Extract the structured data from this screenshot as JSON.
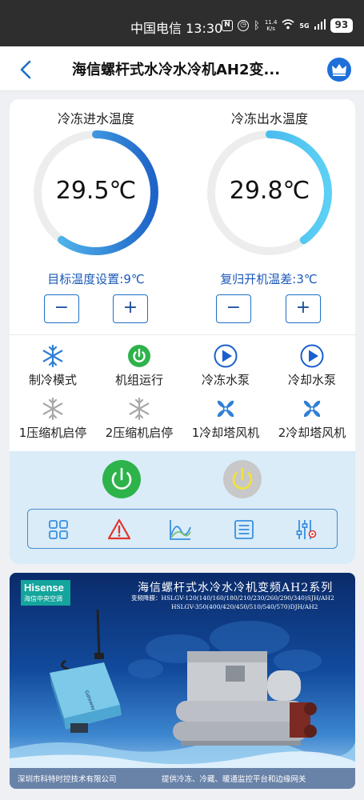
{
  "status_bar": {
    "carrier": "中国电信",
    "time": "13:30",
    "net_speed_value": "11.4",
    "net_speed_unit": "K/s",
    "network": "5G",
    "battery": "93"
  },
  "header": {
    "title": "海信螺杆式水冷水冷机AH2变...",
    "back_icon": "chevron-left-icon",
    "crown_icon": "crown-icon"
  },
  "gauges": [
    {
      "title": "冷冻进水温度",
      "value": "29.5℃",
      "fill_fraction": 0.6
    },
    {
      "title": "冷冻出水温度",
      "value": "29.8℃",
      "fill_fraction": 0.4
    }
  ],
  "settings": [
    {
      "label": "目标温度设置:9℃",
      "minus": "−",
      "plus": "+"
    },
    {
      "label": "复归开机温差:3℃",
      "minus": "−",
      "plus": "+"
    }
  ],
  "status_items": [
    {
      "label": "制冷模式",
      "icon": "snowflake-icon",
      "active": true
    },
    {
      "label": "机组运行",
      "icon": "power-on-icon",
      "active": true
    },
    {
      "label": "冷冻水泵",
      "icon": "play-icon",
      "active": true
    },
    {
      "label": "冷却水泵",
      "icon": "play-icon",
      "active": true
    },
    {
      "label": "1压缩机启停",
      "icon": "snowflake-icon",
      "active": false
    },
    {
      "label": "2压缩机启停",
      "icon": "snowflake-icon",
      "active": false
    },
    {
      "label": "1冷却塔风机",
      "icon": "fan-icon",
      "active": true
    },
    {
      "label": "2冷却塔风机",
      "icon": "fan-icon",
      "active": true
    }
  ],
  "controls": {
    "power_on_icon": "power-on-icon",
    "power_off_icon": "power-off-icon",
    "tools": [
      "grid-icon",
      "warning-icon",
      "chart-icon",
      "list-icon",
      "sliders-icon"
    ]
  },
  "colors": {
    "accent_blue": "#1d6fc6",
    "power_green": "#2db34a",
    "power_grey": "#c8c8c8"
  },
  "banner": {
    "brand": "Hisense",
    "brand_sub": "海信中央空调",
    "title": "海信螺杆式水冷水冷机变频AH2系列",
    "models_line1": "变频降膜：HSLGV-120(140/160/180/210/230/260/290/340)SJH/AH2",
    "models_line2": "HSLGV-350(400/420/450/510/540/570)DJH/AH2",
    "gateway_label": "Gateway",
    "footer_left": "深圳市科特时控技术有限公司",
    "footer_right": "提供冷冻、冷藏、暖通监控平台和边缘网关"
  }
}
